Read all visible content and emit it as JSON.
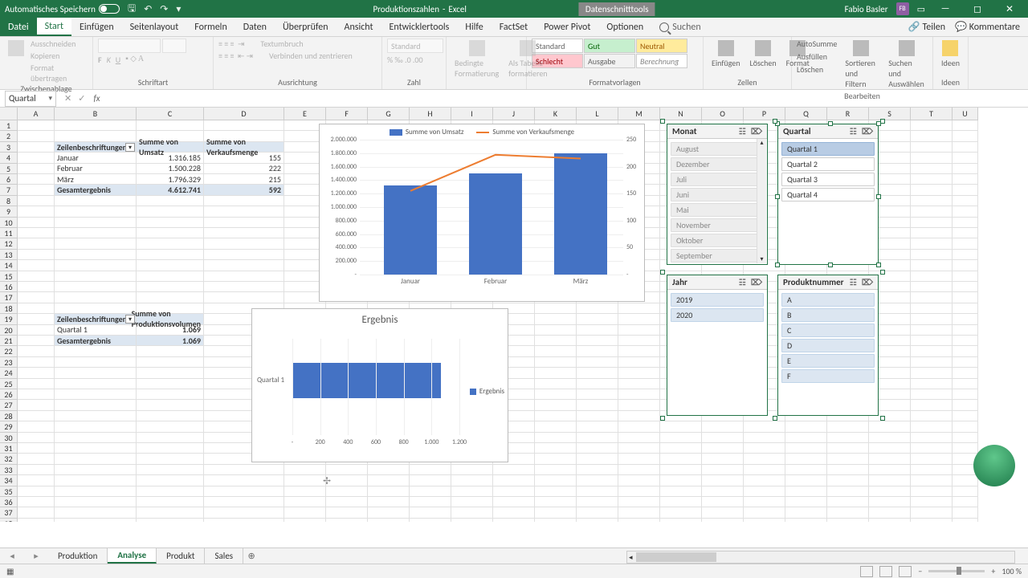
{
  "titlebar": {
    "autosave": "Automatisches Speichern",
    "docname": "Produktionszahlen",
    "app": "Excel",
    "context_tool": "Datenschnitttools",
    "user": "Fabio Basler",
    "user_initials": "FB"
  },
  "tabs": {
    "file": "Datei",
    "start": "Start",
    "einfuegen": "Einfügen",
    "seitenlayout": "Seitenlayout",
    "formeln": "Formeln",
    "daten": "Daten",
    "ueberpruefen": "Überprüfen",
    "ansicht": "Ansicht",
    "entwicklertools": "Entwicklertools",
    "hilfe": "Hilfe",
    "factset": "FactSet",
    "powerpivot": "Power Pivot",
    "optionen": "Optionen",
    "search": "Suchen",
    "teilen": "Teilen",
    "kommentare": "Kommentare"
  },
  "ribbon": {
    "clipboard": {
      "ausschneiden": "Ausschneiden",
      "kopieren": "Kopieren",
      "format": "Format übertragen",
      "label": "Zwischenablage"
    },
    "schriftart": "Schriftart",
    "ausrichtung_label": "Ausrichtung",
    "textumbruch": "Textumbruch",
    "verbinden": "Verbinden und zentrieren",
    "zahl_label": "Zahl",
    "zahl_format": "Standard",
    "bedingte": "Bedingte\nFormatierung",
    "als_tabelle": "Als Tabelle\nformatieren",
    "styles": {
      "standard": "Standard",
      "gut": "Gut",
      "neutral": "Neutral",
      "schlecht": "Schlecht",
      "ausgabe": "Ausgabe",
      "berechnung": "Berechnung"
    },
    "formatvorlagen": "Formatvorlagen",
    "einfuegen_btn": "Einfügen",
    "loeschen": "Löschen",
    "format_btn": "Format",
    "zellen": "Zellen",
    "autosumme": "AutoSumme",
    "ausfuellen": "Ausfüllen",
    "loeschen2": "Löschen",
    "sortieren": "Sortieren und\nFiltern",
    "suchen": "Suchen und\nAuswählen",
    "bearbeiten": "Bearbeiten",
    "ideen": "Ideen"
  },
  "namebox": "Quartal",
  "pivot1": {
    "header_row": "Zeilenbeschriftungen",
    "header_umsatz": "Summe von Umsatz",
    "header_menge": "Summe von Verkaufsmenge",
    "rows": [
      {
        "label": "Januar",
        "umsatz": "1.316.185",
        "menge": "155"
      },
      {
        "label": "Februar",
        "umsatz": "1.500.228",
        "menge": "222"
      },
      {
        "label": "März",
        "umsatz": "1.796.329",
        "menge": "215"
      }
    ],
    "total_label": "Gesamtergebnis",
    "total_umsatz": "4.612.741",
    "total_menge": "592"
  },
  "pivot2": {
    "header_row": "Zeilenbeschriftungen",
    "header_prod": "Summe von Produktionsvolumen",
    "rows": [
      {
        "label": "Quartal 1",
        "val": "1.069"
      }
    ],
    "total_label": "Gesamtergebnis",
    "total_val": "1.069"
  },
  "slicers": {
    "monat": {
      "title": "Monat",
      "items": [
        "August",
        "Dezember",
        "Juli",
        "Juni",
        "Mai",
        "November",
        "Oktober",
        "September"
      ]
    },
    "jahr": {
      "title": "Jahr",
      "items": [
        "2019",
        "2020"
      ]
    },
    "quartal": {
      "title": "Quartal",
      "items": [
        "Quartal 1",
        "Quartal 2",
        "Quartal 3",
        "Quartal 4"
      ]
    },
    "produkt": {
      "title": "Produktnummer",
      "items": [
        "A",
        "B",
        "C",
        "D",
        "E",
        "F"
      ]
    }
  },
  "chart1": {
    "leg_umsatz": "Summe von Umsatz",
    "leg_menge": "Summe von Verkaufsmenge",
    "yticks": [
      "2.000.000",
      "1.800.000",
      "1.600.000",
      "1.400.000",
      "1.200.000",
      "1.000.000",
      "800.000",
      "600.000",
      "400.000",
      "200.000",
      "-"
    ],
    "y2ticks": [
      "250",
      "200",
      "150",
      "100",
      "50",
      "-"
    ],
    "xticks": [
      "Januar",
      "Februar",
      "März"
    ]
  },
  "chart2": {
    "title": "Ergebnis",
    "ylabel": "Quartal 1",
    "legend": "Ergebnis",
    "xticks": [
      "-",
      "200",
      "400",
      "600",
      "800",
      "1.000",
      "1.200"
    ]
  },
  "chart_data": [
    {
      "type": "bar+line",
      "categories": [
        "Januar",
        "Februar",
        "März"
      ],
      "series": [
        {
          "name": "Summe von Umsatz",
          "type": "bar",
          "values": [
            1316185,
            1500228,
            1796329
          ],
          "axis": "left"
        },
        {
          "name": "Summe von Verkaufsmenge",
          "type": "line",
          "values": [
            155,
            222,
            215
          ],
          "axis": "right"
        }
      ],
      "ylabel": "",
      "ylim_left": [
        0,
        2000000
      ],
      "ylim_right": [
        0,
        250
      ]
    },
    {
      "type": "bar-horizontal",
      "title": "Ergebnis",
      "categories": [
        "Quartal 1"
      ],
      "values": [
        1069
      ],
      "xlim": [
        0,
        1200
      ]
    }
  ],
  "sheets": {
    "produktion": "Produktion",
    "analyse": "Analyse",
    "produkt": "Produkt",
    "sales": "Sales"
  },
  "status": {
    "zoom": "100 %"
  }
}
